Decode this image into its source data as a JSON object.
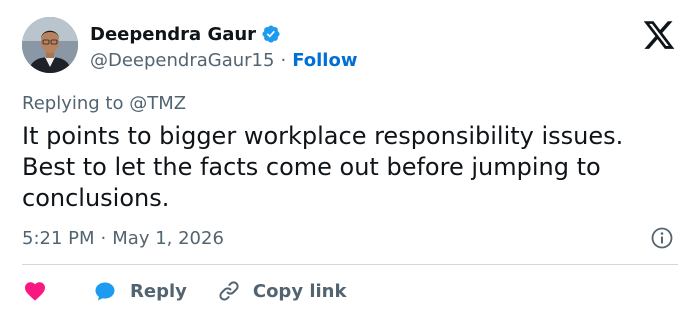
{
  "author": {
    "display_name": "Deependra Gaur",
    "handle": "@DeependraGaur15",
    "separator": "·",
    "follow_label": "Follow",
    "verified": true,
    "verified_color": "#1d9bf0"
  },
  "reply_context": {
    "text": "Replying to @TMZ"
  },
  "tweet": {
    "text": "It points to bigger workplace responsibility issues. Best to let the facts come out before jumping to conclusions.",
    "time": "5:21 PM",
    "separator": "·",
    "date": "May 1, 2026"
  },
  "actions": {
    "like_icon": "heart-icon",
    "reply_label": "Reply",
    "copy_label": "Copy link"
  },
  "colors": {
    "like": "#f91880",
    "reply": "#1d9bf0",
    "follow": "#006fd6",
    "muted": "#536471",
    "text": "#0f1419"
  },
  "icons": {
    "logo": "x-logo-icon",
    "info": "info-icon",
    "link": "link-icon"
  }
}
